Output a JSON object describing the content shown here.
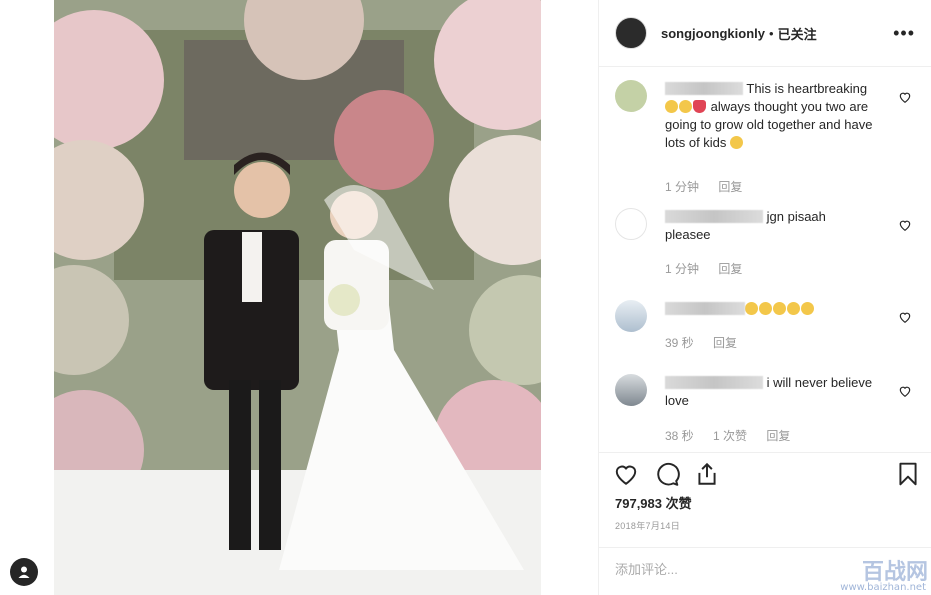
{
  "post": {
    "username": "songjoongkionly",
    "separator": "•",
    "follow_status": "已关注",
    "more_label": "•••",
    "image_alt": "wedding photo"
  },
  "comments": [
    {
      "text": "This is heartbreaking",
      "text2": "always thought you two are going to grow old together and have lots of kids",
      "time": "1 分钟",
      "reply": "回复"
    },
    {
      "text": "jgn pisaah",
      "text2": "pleasee",
      "time": "1 分钟",
      "reply": "回复"
    },
    {
      "text": "",
      "time": "39 秒",
      "reply": "回复"
    },
    {
      "text": "i will never believe",
      "text2": "love",
      "time": "38 秒",
      "likes": "1 次赞",
      "reply": "回复"
    }
  ],
  "stats": {
    "likes": "797,983 次赞",
    "date": "2018年7月14日"
  },
  "add_comment": {
    "placeholder": "添加评论..."
  },
  "watermark": {
    "text": "百战网",
    "url": "www.baizhan.net"
  },
  "icons": [
    "user-tag-icon",
    "more-icon",
    "heart-icon",
    "comment-icon",
    "share-icon",
    "bookmark-icon"
  ],
  "colors": {
    "text": "#262626",
    "muted": "#999999",
    "border": "#efefef"
  }
}
